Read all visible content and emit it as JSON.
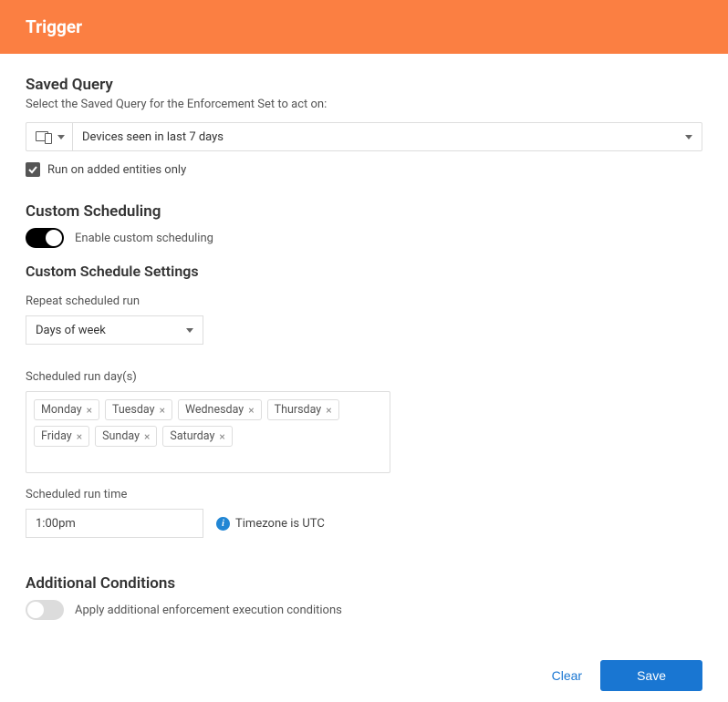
{
  "header": {
    "title": "Trigger"
  },
  "savedQuery": {
    "title": "Saved Query",
    "subtitle": "Select the Saved Query for the Enforcement Set to act on:",
    "selected": "Devices seen in last 7 days",
    "runOnAddedLabel": "Run on added entities only",
    "runOnAddedChecked": true
  },
  "customScheduling": {
    "title": "Custom Scheduling",
    "toggleLabel": "Enable custom scheduling",
    "enabled": true
  },
  "scheduleSettings": {
    "title": "Custom Schedule Settings",
    "repeatLabel": "Repeat scheduled run",
    "repeatValue": "Days of week",
    "daysLabel": "Scheduled run day(s)",
    "days": [
      "Monday",
      "Tuesday",
      "Wednesday",
      "Thursday",
      "Friday",
      "Sunday",
      "Saturday"
    ],
    "timeLabel": "Scheduled run time",
    "timeValue": "1:00pm",
    "timezoneLabel": "Timezone is UTC"
  },
  "additionalConditions": {
    "title": "Additional Conditions",
    "toggleLabel": "Apply additional enforcement execution conditions",
    "enabled": false
  },
  "footer": {
    "clearLabel": "Clear",
    "saveLabel": "Save"
  }
}
